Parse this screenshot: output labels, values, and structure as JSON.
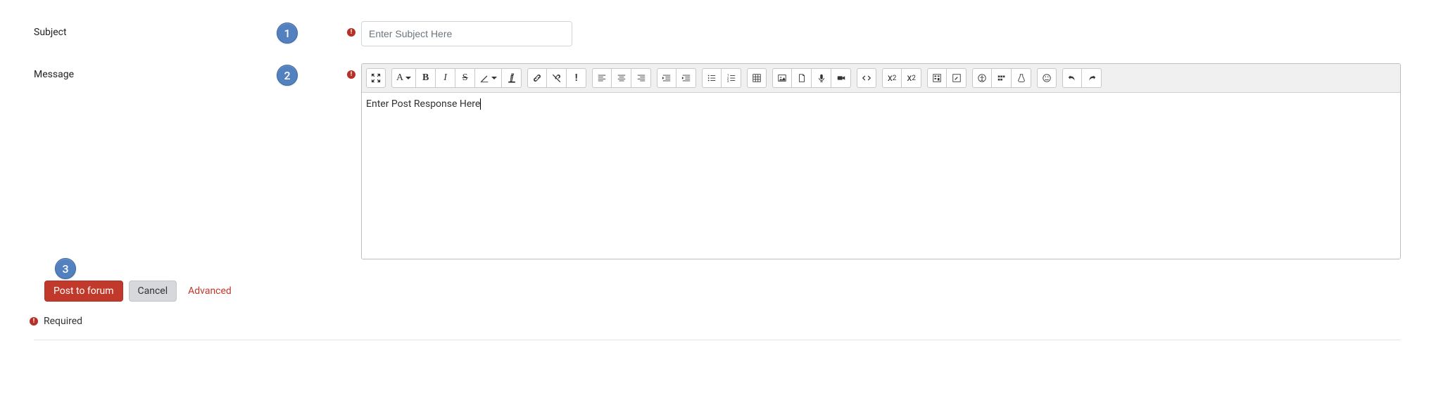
{
  "form": {
    "subject": {
      "label": "Subject",
      "placeholder": "Enter Subject Here",
      "value": ""
    },
    "message": {
      "label": "Message",
      "content": "Enter Post Response Here"
    }
  },
  "badges": {
    "one": "1",
    "two": "2",
    "three": "3"
  },
  "required_mark": "!",
  "toolbar": {
    "paragraph_label": "A",
    "bold": "B",
    "italic": "I",
    "strike": "S",
    "excl": "!",
    "sub_x": "x",
    "sub_2": "2",
    "sup_x": "x",
    "sup_2": "2"
  },
  "buttons": {
    "post": "Post to forum",
    "cancel": "Cancel",
    "advanced": "Advanced"
  },
  "required_text": "Required"
}
